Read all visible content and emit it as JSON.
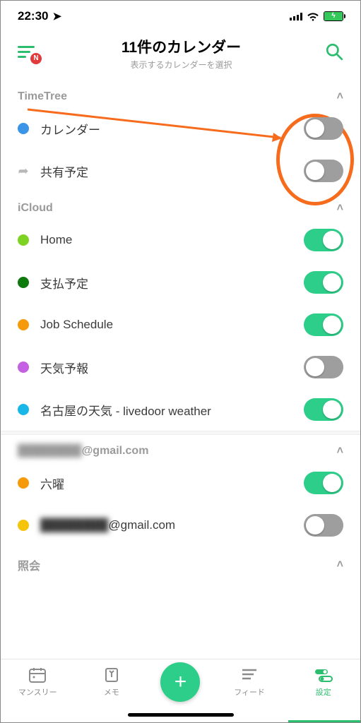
{
  "status": {
    "time": "22:30"
  },
  "header": {
    "title": "11件のカレンダー",
    "subtitle": "表示するカレンダーを選択",
    "menu_badge": "N"
  },
  "sections": {
    "timetree": {
      "title": "TimeTree",
      "cal_label": "カレンダー",
      "share_label": "共有予定"
    },
    "icloud": {
      "title": "iCloud",
      "items": [
        {
          "label": "Home",
          "color": "#7ed221",
          "on": true
        },
        {
          "label": "支払予定",
          "color": "#0e7a0e",
          "on": true
        },
        {
          "label": "Job Schedule",
          "color": "#f59b0b",
          "on": true
        },
        {
          "label": "天気予報",
          "color": "#c560e2",
          "on": false
        },
        {
          "label": "名古屋の天気 - livedoor weather",
          "color": "#19b6e8",
          "on": true
        }
      ]
    },
    "gmail": {
      "title_suffix": "@gmail.com",
      "items": [
        {
          "label": "六曜",
          "color": "#f59b0b",
          "on": true
        },
        {
          "label_suffix": "@gmail.com",
          "color": "#f5c40b",
          "on": false
        }
      ]
    },
    "subscribed": {
      "title": "照会"
    }
  },
  "colors": {
    "timetree_cal": "#3a94e8"
  },
  "tabs": {
    "monthly": "マンスリー",
    "memo": "メモ",
    "feed": "フィード",
    "settings": "設定"
  }
}
